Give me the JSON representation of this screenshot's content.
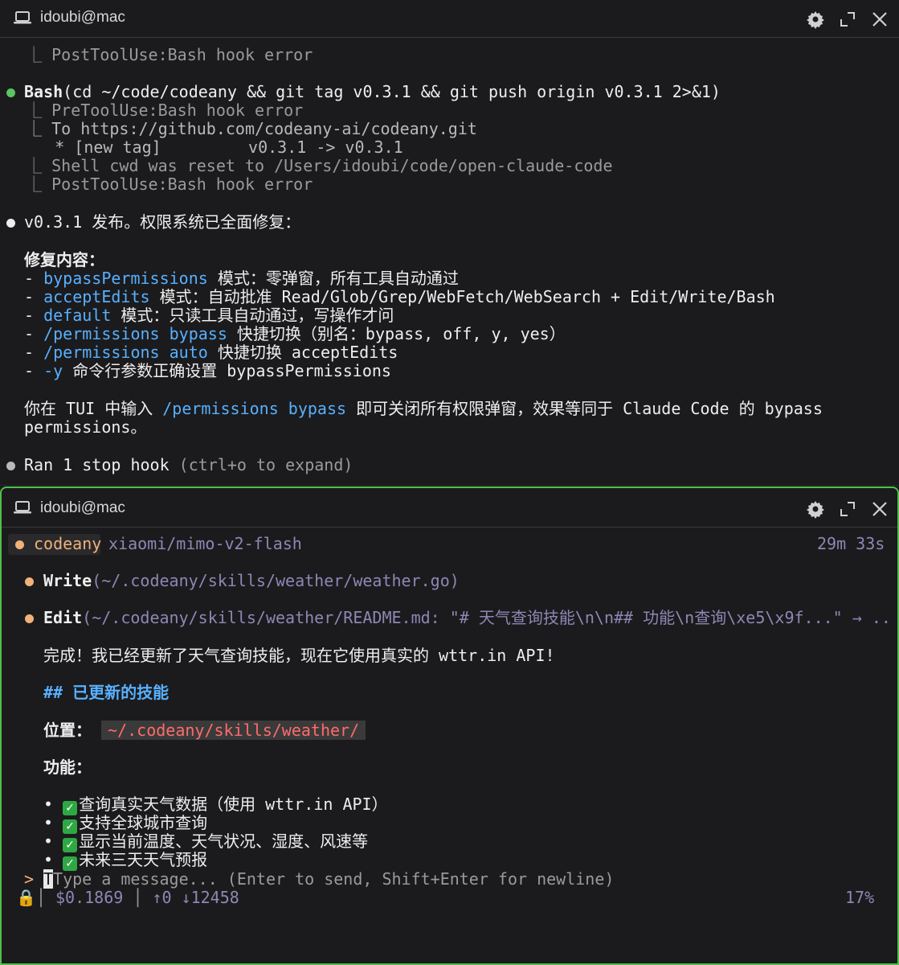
{
  "pane_top": {
    "title": "idoubi@mac",
    "lines": {
      "l1": "  ⎿ PostToolUse:Bash hook error",
      "bash_cmd": "(cd ~/code/codeany && git tag v0.3.1 && git push origin v0.3.1 2>&1)",
      "bash_label": "Bash",
      "l3": "  ⎿ PreToolUse:Bash hook error",
      "l4": "  ⎿ To https://github.com/codeany-ai/codeany.git",
      "l5": "     * [new tag]         v0.3.1 -> v0.3.1",
      "l6": "  ⎿ Shell cwd was reset to /Users/idoubi/code/open-claude-code",
      "l7": "  ⎿ PostToolUse:Bash hook error",
      "release": "v0.3.1 发布。权限系统已全面修复：",
      "fix_heading": "修复内容：",
      "f1_key": "bypassPermissions",
      "f1_rest": " 模式：零弹窗，所有工具自动通过",
      "f2_key": "acceptEdits",
      "f2_rest": " 模式：自动批准 Read/Glob/Grep/WebFetch/WebSearch + Edit/Write/Bash",
      "f3_key": "default",
      "f3_rest": " 模式：只读工具自动通过，写操作才问",
      "f4_key": "/permissions bypass",
      "f4_rest": " 快捷切换（别名：bypass, off, y, yes）",
      "f5_key": "/permissions auto",
      "f5_rest": " 快捷切换 acceptEdits",
      "f6_key": "-y",
      "f6_rest": " 命令行参数正确设置 bypassPermissions",
      "p1_a": "你在 TUI 中输入 ",
      "p1_key": "/permissions bypass",
      "p1_b": " 即可关闭所有权限弹窗，效果等同于 Claude Code 的 bypass",
      "p1_c": "permissions。",
      "ran": "Ran 1 stop hook",
      "ran_hint": " (ctrl+o to expand)"
    }
  },
  "pane_bottom": {
    "title": "idoubi@mac",
    "app_name": "codeany",
    "model": "xiaomi/mimo-v2-flash",
    "elapsed": "29m 33s",
    "write_label": "Write",
    "write_arg": "(~/.codeany/skills/weather/weather.go)",
    "edit_label": "Edit",
    "edit_arg": "(~/.codeany/skills/weather/README.md: \"# 天气查询技能\\n\\n## 功能\\n查询\\xe5\\x9f...\" → ..",
    "done": "完成！我已经更新了天气查询技能，现在它使用真实的 wttr.in API!",
    "section": "## 已更新的技能",
    "location_label": "位置：",
    "location_value": "~/.codeany/skills/weather/",
    "features_label": "功能：",
    "features": [
      "查询真实天气数据（使用 wttr.in API）",
      "支持全球城市查询",
      "显示当前温度、天气状况、湿度、风速等",
      "未来三天天气预报"
    ],
    "prompt": ">",
    "input_placeholder": "Type a message... (Enter to send, Shift+Enter for newline)",
    "cost": "$0.1869",
    "tokens": "↑0 ↓12458",
    "context_pct": "17%"
  }
}
